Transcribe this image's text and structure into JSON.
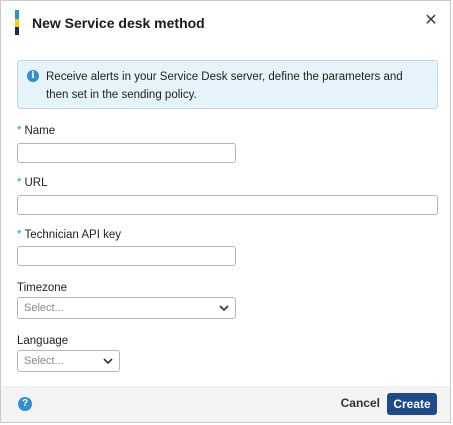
{
  "dialog": {
    "title": "New Service desk method",
    "close_icon": "close-icon"
  },
  "info": {
    "icon": "info-icon",
    "text": "Receive alerts in your Service Desk server, define the parameters and then set in the sending policy."
  },
  "form": {
    "required_marker": "*",
    "name": {
      "label": "Name",
      "value": ""
    },
    "url": {
      "label": "URL",
      "value": ""
    },
    "api_key": {
      "label": "Technician API key",
      "value": ""
    },
    "timezone": {
      "label": "Timezone",
      "selected": "Select..."
    },
    "language": {
      "label": "Language",
      "selected": "Select..."
    }
  },
  "footer": {
    "help_icon": "help-icon",
    "cancel_label": "Cancel",
    "create_label": "Create"
  },
  "colors": {
    "accent_top": "#1e9bd7",
    "accent_mid": "#f2d40a",
    "accent_bottom": "#1b2a4a",
    "info_bg": "#e6f3fb",
    "info_icon": "#2f8fd0",
    "required": "#1e9bd7",
    "primary": "#1c4a8a",
    "help": "#2f8fd0"
  }
}
